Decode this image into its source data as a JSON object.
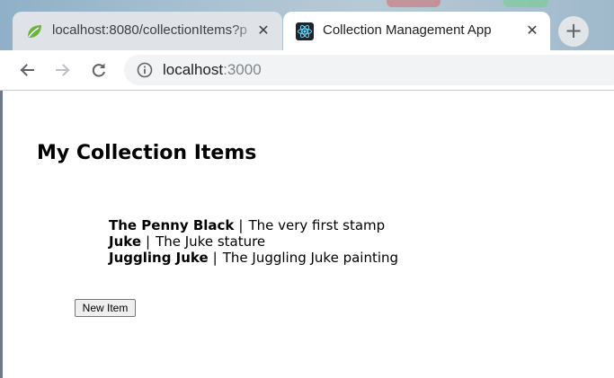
{
  "browser": {
    "tabs": [
      {
        "title": "localhost:8080/collectionItems?p",
        "icon": "spring-leaf-icon",
        "close_glyph": "✕",
        "active": false
      },
      {
        "title": "Collection Management App",
        "icon": "react-logo-icon",
        "close_glyph": "✕",
        "active": true
      }
    ],
    "new_tab_glyph": "+",
    "address_bar": {
      "host": "localhost",
      "port": ":3000"
    },
    "colors": {
      "active_tab": "#ffffff",
      "inactive_tab": "#dfe3e7",
      "omnibox": "#f1f3f4"
    }
  },
  "page": {
    "title": "My Collection Items",
    "separator": "|",
    "items": [
      {
        "name": "The Penny Black",
        "description": "The very first stamp"
      },
      {
        "name": "Juke",
        "description": "The Juke stature"
      },
      {
        "name": "Juggling Juke",
        "description": "The Juggling Juke painting"
      }
    ],
    "new_item_label": "New Item"
  }
}
